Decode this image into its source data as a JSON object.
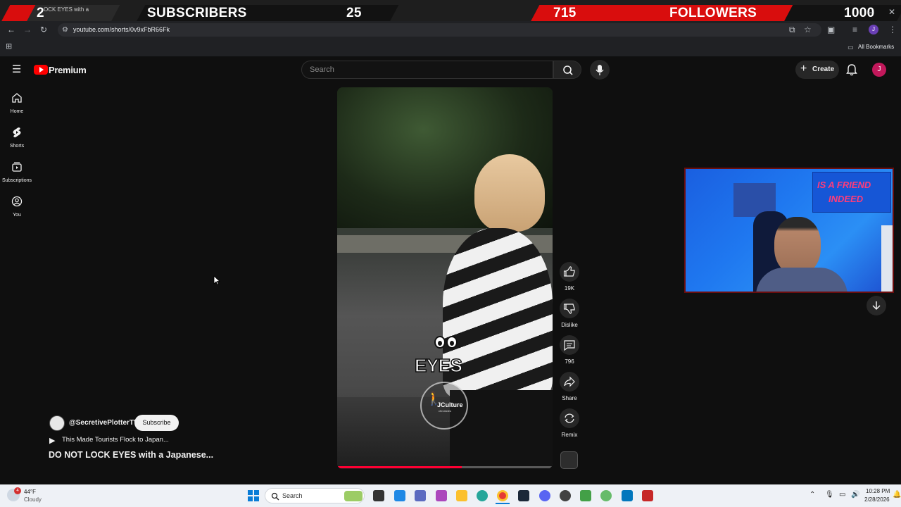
{
  "overlay": {
    "left_count": "2",
    "subscribers_label": "SUBSCRIBERS",
    "subscribers_goal": "25",
    "followers_count": "715",
    "followers_label": "FOLLOWERS",
    "followers_goal": "1000",
    "tab_title": "OCK EYES with a",
    "accent": "#d90d0d"
  },
  "browser": {
    "url": "youtube.com/shorts/0v9xFbR66Fk",
    "bookmarks_label": "All Bookmarks",
    "profile_initial": "J"
  },
  "header": {
    "logo_text": "Premium",
    "search_placeholder": "Search",
    "create_label": "Create",
    "avatar_initial": "J"
  },
  "nav": [
    {
      "label": "Home",
      "icon": "home-icon"
    },
    {
      "label": "Shorts",
      "icon": "shorts-icon"
    },
    {
      "label": "Subscriptions",
      "icon": "subscriptions-icon"
    },
    {
      "label": "You",
      "icon": "you-icon"
    }
  ],
  "short": {
    "overlay_text": "EYES",
    "watermark": "JCulture",
    "watermark_sub": "chronicles",
    "channel": "@SecretivePlotterTV",
    "subscribe_label": "Subscribe",
    "playlist_text": "This Made Tourists Flock to Japan...",
    "title": "DO NOT LOCK EYES with a Japanese...",
    "progress_fraction": 0.58
  },
  "actions": {
    "likes": "19K",
    "dislike_label": "Dislike",
    "comments": "796",
    "share_label": "Share",
    "remix_label": "Remix"
  },
  "webcam": {
    "sign_text_1": "IS A FRIEND",
    "sign_text_2": "INDEED"
  },
  "taskbar": {
    "weather_temp": "44°F",
    "weather_desc": "Cloudy",
    "weather_badge": "4",
    "search_label": "Search",
    "time": "10:28 PM",
    "date": "2/28/2026"
  }
}
